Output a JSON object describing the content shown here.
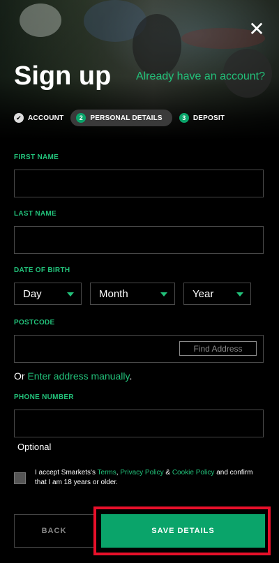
{
  "header": {
    "title": "Sign up",
    "signin_link": "Already have an account?",
    "close_glyph": "✕"
  },
  "steps": [
    {
      "marker": "✔",
      "label": "ACCOUNT",
      "state": "done"
    },
    {
      "marker": "2",
      "label": "PERSONAL DETAILS",
      "state": "active"
    },
    {
      "marker": "3",
      "label": "DEPOSIT",
      "state": "pending"
    }
  ],
  "form": {
    "first_name": {
      "label": "FIRST NAME",
      "value": ""
    },
    "last_name": {
      "label": "LAST NAME",
      "value": ""
    },
    "dob": {
      "label": "DATE OF BIRTH",
      "day": "Day",
      "month": "Month",
      "year": "Year"
    },
    "postcode": {
      "label": "POSTCODE",
      "value": "",
      "find_button": "Find Address"
    },
    "manual": {
      "prefix": "Or ",
      "link": "Enter address manually",
      "suffix": "."
    },
    "phone": {
      "label": "PHONE NUMBER",
      "value": "",
      "hint": "Optional"
    },
    "terms": {
      "t1": "I accept Smarkets's ",
      "terms_link": "Terms",
      "t2": ", ",
      "privacy_link": "Privacy Policy",
      "t3": " & ",
      "cookie_link": "Cookie Policy",
      "t4": " and confirm that I am 18 years or older.",
      "checked": false
    }
  },
  "actions": {
    "back": "BACK",
    "save": "SAVE DETAILS"
  },
  "colors": {
    "accent": "#0aa46a",
    "link": "#22c17a",
    "highlight": "#e8102a"
  }
}
